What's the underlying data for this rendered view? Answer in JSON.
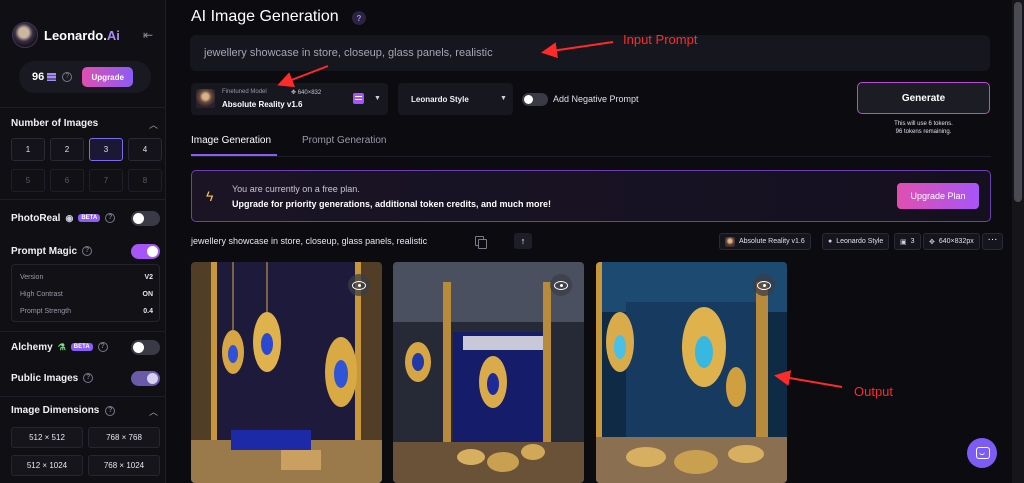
{
  "sidebar": {
    "brand": {
      "name": "Leonardo.",
      "suffix": "Ai"
    },
    "tokens": {
      "count": "96",
      "upgrade_label": "Upgrade"
    },
    "num_images": {
      "title": "Number of Images",
      "options": [
        "1",
        "2",
        "3",
        "4",
        "5",
        "6",
        "7",
        "8"
      ],
      "selected": "3"
    },
    "photoreal": {
      "label": "PhotoReal",
      "badge": "BETA",
      "enabled": false
    },
    "prompt_magic": {
      "label": "Prompt Magic",
      "enabled": true,
      "rows": [
        {
          "label": "Version",
          "value": "V2"
        },
        {
          "label": "High Contrast",
          "value": "ON"
        },
        {
          "label": "Prompt Strength",
          "value": "0.4"
        }
      ]
    },
    "alchemy": {
      "label": "Alchemy",
      "badge": "BETA",
      "enabled": false
    },
    "public_images": {
      "label": "Public Images",
      "enabled": true
    },
    "image_dimensions": {
      "title": "Image Dimensions",
      "options": [
        "512 × 512",
        "768 × 768",
        "512 × 1024",
        "768 × 1024"
      ]
    }
  },
  "main": {
    "title": "AI Image Generation",
    "prompt_value": "jewellery showcase in store, closeup, glass panels, realistic",
    "model": {
      "small_label": "Finetuned Model",
      "dims": "640×832",
      "name": "Absolute Reality v1.6"
    },
    "style_select": "Leonardo Style",
    "negative_prompt_label": "Add Negative Prompt",
    "generate_label": "Generate",
    "generate_note_1": "This will use 6 tokens.",
    "generate_note_2": "96 tokens remaining.",
    "tabs": [
      "Image Generation",
      "Prompt Generation"
    ],
    "active_tab": "Image Generation",
    "banner": {
      "line1": "You are currently on a free plan.",
      "line2": "Upgrade for priority generations, additional token credits, and much more!",
      "button": "Upgrade Plan"
    },
    "result": {
      "prompt": "jewellery showcase in store, closeup, glass panels, realistic",
      "chips": {
        "model": "Absolute Reality v1.6",
        "style": "Leonardo Style",
        "count": "3",
        "dims": "640×832px"
      },
      "more": "···"
    }
  },
  "annotations": {
    "input_label": "Input Prompt",
    "output_label": "Output",
    "color": "#ff2a2a"
  },
  "colors": {
    "accent": "#8b5cf6",
    "pink": "#e04fb0",
    "background": "#0b0b10"
  }
}
